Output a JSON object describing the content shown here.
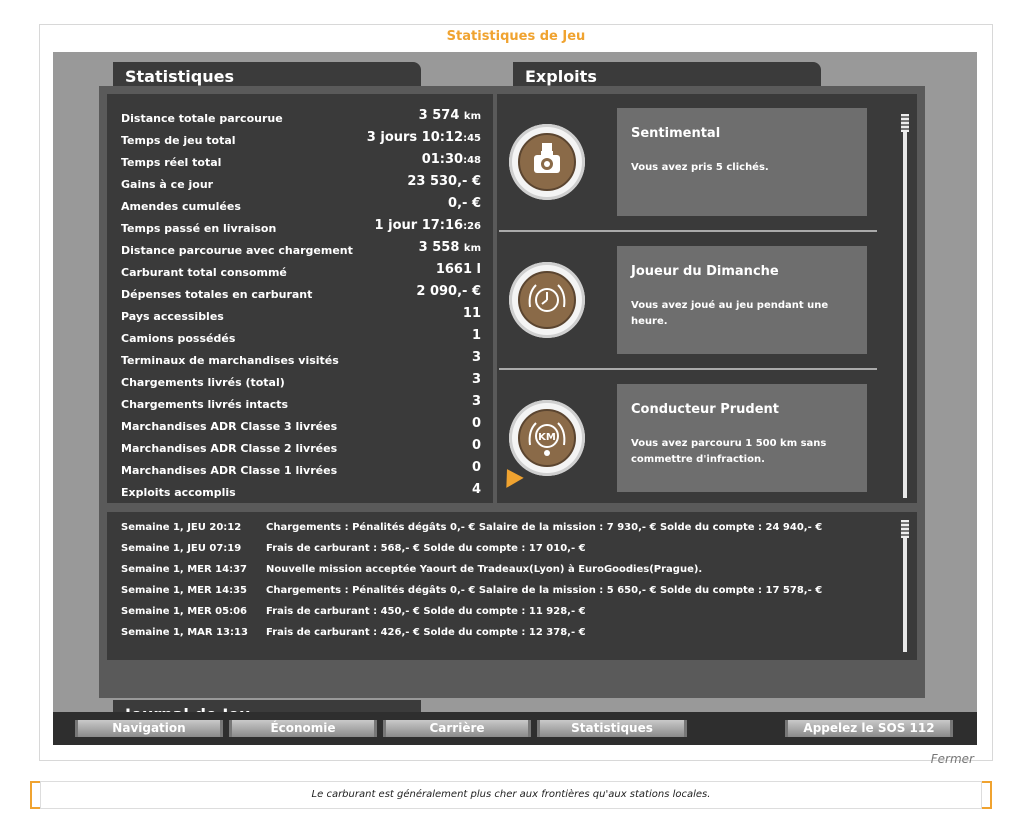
{
  "window_title": "Statistiques de Jeu",
  "headers": {
    "stats": "Statistiques",
    "exploits": "Exploits",
    "journal": "Journal de Jeu"
  },
  "stats": [
    {
      "label": "Distance totale parcourue",
      "value": "3 574",
      "unit": "km"
    },
    {
      "label": "Temps de jeu total",
      "value": "3 jours 10:12",
      "unit": ":45"
    },
    {
      "label": "Temps réel total",
      "value": "01:30",
      "unit": ":48"
    },
    {
      "label": "Gains à ce jour",
      "value": "23 530,- €",
      "unit": ""
    },
    {
      "label": "Amendes cumulées",
      "value": "0,- €",
      "unit": ""
    },
    {
      "label": "Temps passé en livraison",
      "value": "1 jour 17:16",
      "unit": ":26"
    },
    {
      "label": "Distance parcourue avec chargement",
      "value": "3 558",
      "unit": "km"
    },
    {
      "label": "Carburant total consommé",
      "value": "1661 l",
      "unit": ""
    },
    {
      "label": "Dépenses totales en carburant",
      "value": "2 090,- €",
      "unit": ""
    },
    {
      "label": "Pays accessibles",
      "value": "11",
      "unit": ""
    },
    {
      "label": "Camions possédés",
      "value": "1",
      "unit": ""
    },
    {
      "label": "Terminaux de marchandises visités",
      "value": "3",
      "unit": ""
    },
    {
      "label": "Chargements livrés (total)",
      "value": "3",
      "unit": ""
    },
    {
      "label": "Chargements livrés intacts",
      "value": "3",
      "unit": ""
    },
    {
      "label": "Marchandises ADR Classe 3 livrées",
      "value": "0",
      "unit": ""
    },
    {
      "label": "Marchandises ADR Classe 2 livrées",
      "value": "0",
      "unit": ""
    },
    {
      "label": "Marchandises ADR Classe 1 livrées",
      "value": "0",
      "unit": ""
    },
    {
      "label": "Exploits accomplis",
      "value": "4",
      "unit": ""
    }
  ],
  "achievements": [
    {
      "title": "Sentimental",
      "desc": "Vous avez pris 5 clichés.",
      "icon": "camera-icon"
    },
    {
      "title": "Joueur du Dimanche",
      "desc": "Vous avez joué au jeu pendant une heure.",
      "icon": "clock-icon"
    },
    {
      "title": "Conducteur Prudent",
      "desc": "Vous avez parcouru 1 500 km sans commettre d'infraction.",
      "icon": "km-badge-icon",
      "badge_text": "KM"
    }
  ],
  "journal": [
    {
      "date": "Semaine 1, JEU 20:12",
      "text": "Chargements : Pénalités dégâts 0,- € Salaire de la mission : 7 930,- € Solde du compte : 24 940,- €"
    },
    {
      "date": "Semaine 1, JEU 07:19",
      "text": "Frais de carburant : 568,- € Solde du compte : 17 010,- €"
    },
    {
      "date": "Semaine 1, MER 14:37",
      "text": "Nouvelle mission acceptée Yaourt de Tradeaux(Lyon) à EuroGoodies(Prague)."
    },
    {
      "date": "Semaine 1, MER 14:35",
      "text": "Chargements : Pénalités dégâts 0,- € Salaire de la mission : 5 650,- € Solde du compte : 17 578,- €"
    },
    {
      "date": "Semaine 1, MER 05:06",
      "text": "Frais de carburant : 450,- € Solde du compte : 11 928,- €"
    },
    {
      "date": "Semaine 1, MAR 13:13",
      "text": "Frais de carburant : 426,- € Solde du compte : 12 378,- €"
    }
  ],
  "nav": {
    "navigation": "Navigation",
    "economie": "Économie",
    "carriere": "Carrière",
    "statistiques": "Statistiques",
    "sos": "Appelez le SOS 112"
  },
  "close_label": "Fermer",
  "tip": "Le carburant est généralement plus cher aux frontières qu'aux stations locales.",
  "colors": {
    "accent": "#f0a330",
    "panel": "#3a3a3a",
    "frame": "#999999"
  }
}
